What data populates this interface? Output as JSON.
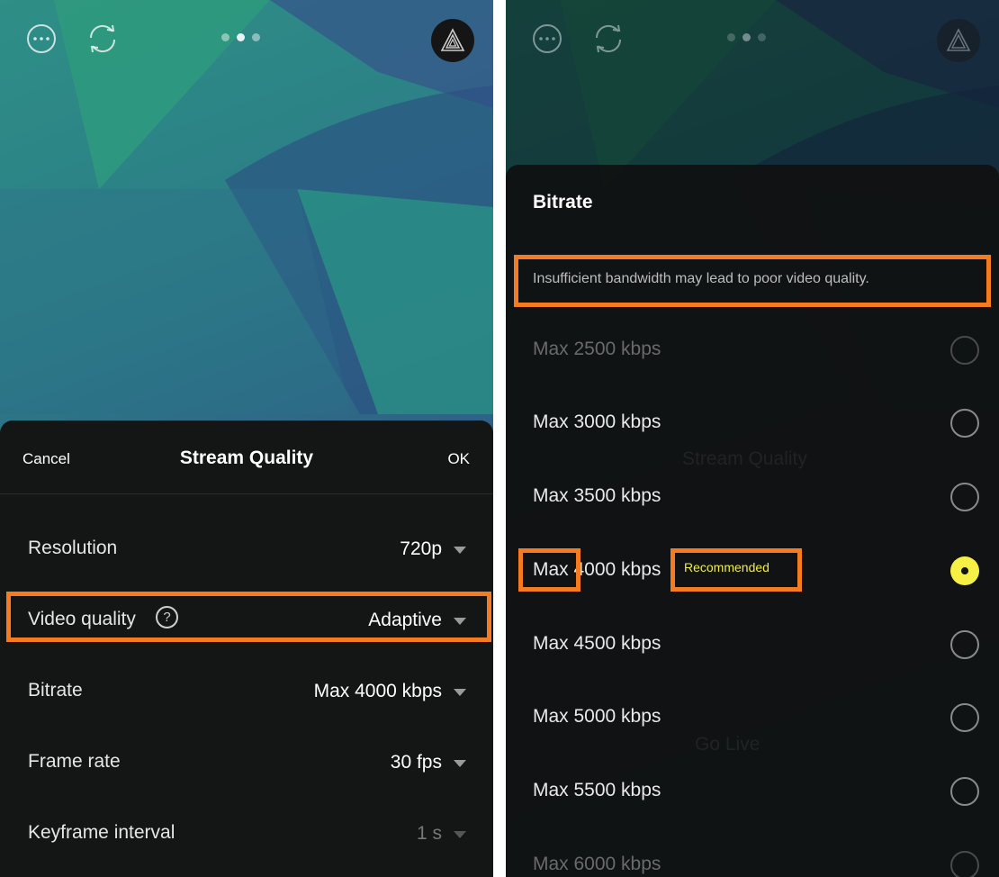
{
  "left_panel": {
    "topbar": {
      "more_icon": "ellipsis-circle-icon",
      "refresh_icon": "refresh-icon",
      "page_dots": 3,
      "active_dot": 2,
      "logo_icon": "triangle-logo-icon"
    },
    "sheet": {
      "cancel_label": "Cancel",
      "title": "Stream Quality",
      "ok_label": "OK",
      "rows": [
        {
          "label": "Resolution",
          "value": "720p"
        },
        {
          "label": "Video quality",
          "value": "Adaptive",
          "help_glyph": "?"
        },
        {
          "label": "Bitrate",
          "value": "Max 4000 kbps"
        },
        {
          "label": "Frame rate",
          "value": "30 fps"
        },
        {
          "label": "Keyframe interval",
          "value": "1 s"
        }
      ]
    }
  },
  "right_panel": {
    "background_ghost_texts": [
      "Stream Quality",
      "Go Live"
    ],
    "sheet": {
      "title": "Bitrate",
      "warning": "Insufficient bandwidth may lead to poor video quality.",
      "options": [
        {
          "label": "Max 2500 kbps",
          "selected": false
        },
        {
          "label": "Max 3000 kbps",
          "selected": false
        },
        {
          "label": "Max 3500 kbps",
          "selected": false
        },
        {
          "label": "Max 4000 kbps",
          "selected": true,
          "badge": "Recommended"
        },
        {
          "label": "Max 4500 kbps",
          "selected": false
        },
        {
          "label": "Max 5000 kbps",
          "selected": false
        },
        {
          "label": "Max 5500 kbps",
          "selected": false
        },
        {
          "label": "Max 6000 kbps",
          "selected": false
        }
      ]
    }
  },
  "colors": {
    "highlight": "#f47b20",
    "accent_yellow": "#f6ef45",
    "sheet_bg": "#141515"
  }
}
